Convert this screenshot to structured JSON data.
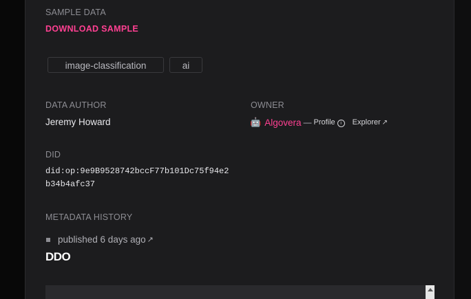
{
  "sample": {
    "label": "SAMPLE DATA",
    "download_label": "DOWNLOAD SAMPLE"
  },
  "tags": [
    "image-classification",
    "ai"
  ],
  "author": {
    "label": "DATA AUTHOR",
    "value": "Jeremy Howard"
  },
  "owner": {
    "label": "OWNER",
    "avatar": "🤖",
    "name": "Algovera",
    "separator": "—",
    "profile_label": "Profile",
    "explorer_label": "Explorer"
  },
  "did": {
    "label": "DID",
    "line1": "did:op:9e9B9528742bccF77b101Dc75f94e2",
    "line2": "b34b4afc37"
  },
  "metadata_history": {
    "label": "METADATA HISTORY",
    "entry": "published 6 days ago"
  },
  "ddo": {
    "title": "DDO"
  },
  "colors": {
    "accent": "#ff4092",
    "panel": "#1c1c1e",
    "label": "#8d8d93"
  }
}
